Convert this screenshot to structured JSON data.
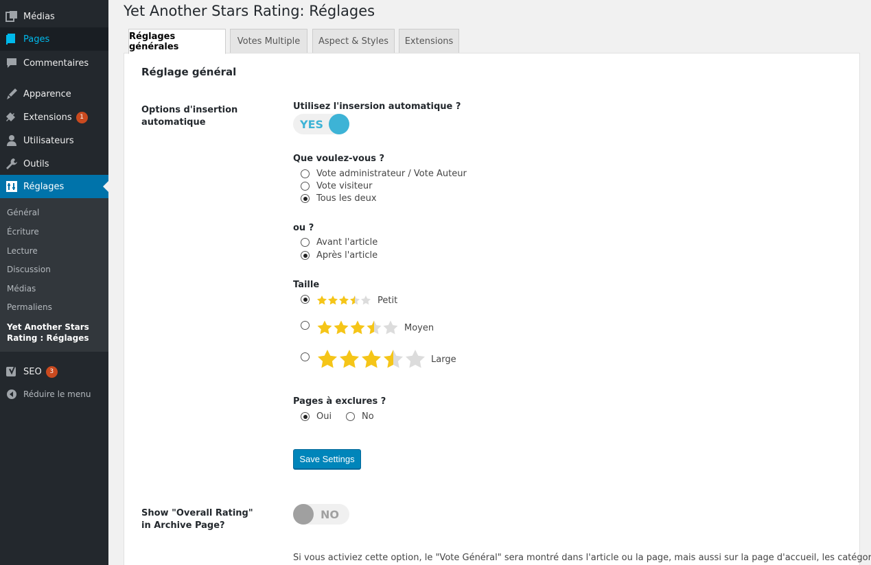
{
  "sidebar": {
    "items": [
      {
        "label": "Médias",
        "icon": "media-icon"
      },
      {
        "label": "Pages",
        "icon": "pages-icon"
      },
      {
        "label": "Commentaires",
        "icon": "comments-icon"
      },
      {
        "label": "Apparence",
        "icon": "appearance-icon"
      },
      {
        "label": "Extensions",
        "icon": "plugins-icon",
        "badge": "1"
      },
      {
        "label": "Utilisateurs",
        "icon": "users-icon"
      },
      {
        "label": "Outils",
        "icon": "tools-icon"
      },
      {
        "label": "Réglages",
        "icon": "settings-icon"
      },
      {
        "label": "SEO",
        "icon": "yoast-icon",
        "badge": "3"
      },
      {
        "label": "Réduire le menu",
        "icon": "collapse-icon"
      }
    ],
    "submenu": [
      "Général",
      "Écriture",
      "Lecture",
      "Discussion",
      "Médias",
      "Permaliens",
      "Yet Another Stars Rating : Réglages"
    ]
  },
  "page": {
    "title": "Yet Another Stars Rating: Réglages",
    "tabs": [
      "Réglages générales",
      "Votes Multiple",
      "Aspect & Styles",
      "Extensions"
    ]
  },
  "panel": {
    "section_title": "Réglage général",
    "auto_insert": {
      "row_label": "Options d'insertion automatique",
      "use_title": "Utilisez l'insersion automatique ?",
      "toggle_label": "YES",
      "what_title": "Que voulez-vous ?",
      "what_options": [
        "Vote administrateur / Vote Auteur",
        "Vote visiteur",
        "Tous les deux"
      ],
      "where_title": "ou ?",
      "where_options": [
        "Avant l'article",
        "Après l'article"
      ],
      "size_title": "Taille",
      "size_options": [
        "Petit",
        "Moyen",
        "Large"
      ],
      "rating_shown": 3.5,
      "exclude_title": "Pages à exclures ?",
      "exclude_options": [
        "Oui",
        "No"
      ],
      "save_label": "Save Settings"
    },
    "overall": {
      "row_label": "Show \"Overall Rating\" in Archive Page?",
      "toggle_label": "NO",
      "description": "Si vous activiez cette option, le \"Vote Général\" sera montré dans l'article ou la page, mais aussi sur la page d'accueil, les catégories"
    }
  },
  "colors": {
    "sidebar_bg": "#23282d",
    "accent": "#0073aa",
    "toggle_on": "#3db3d6",
    "star_fill": "#f5c518",
    "star_empty": "#dcdcdc",
    "button": "#0085ba",
    "badge": "#ca4a1f"
  }
}
